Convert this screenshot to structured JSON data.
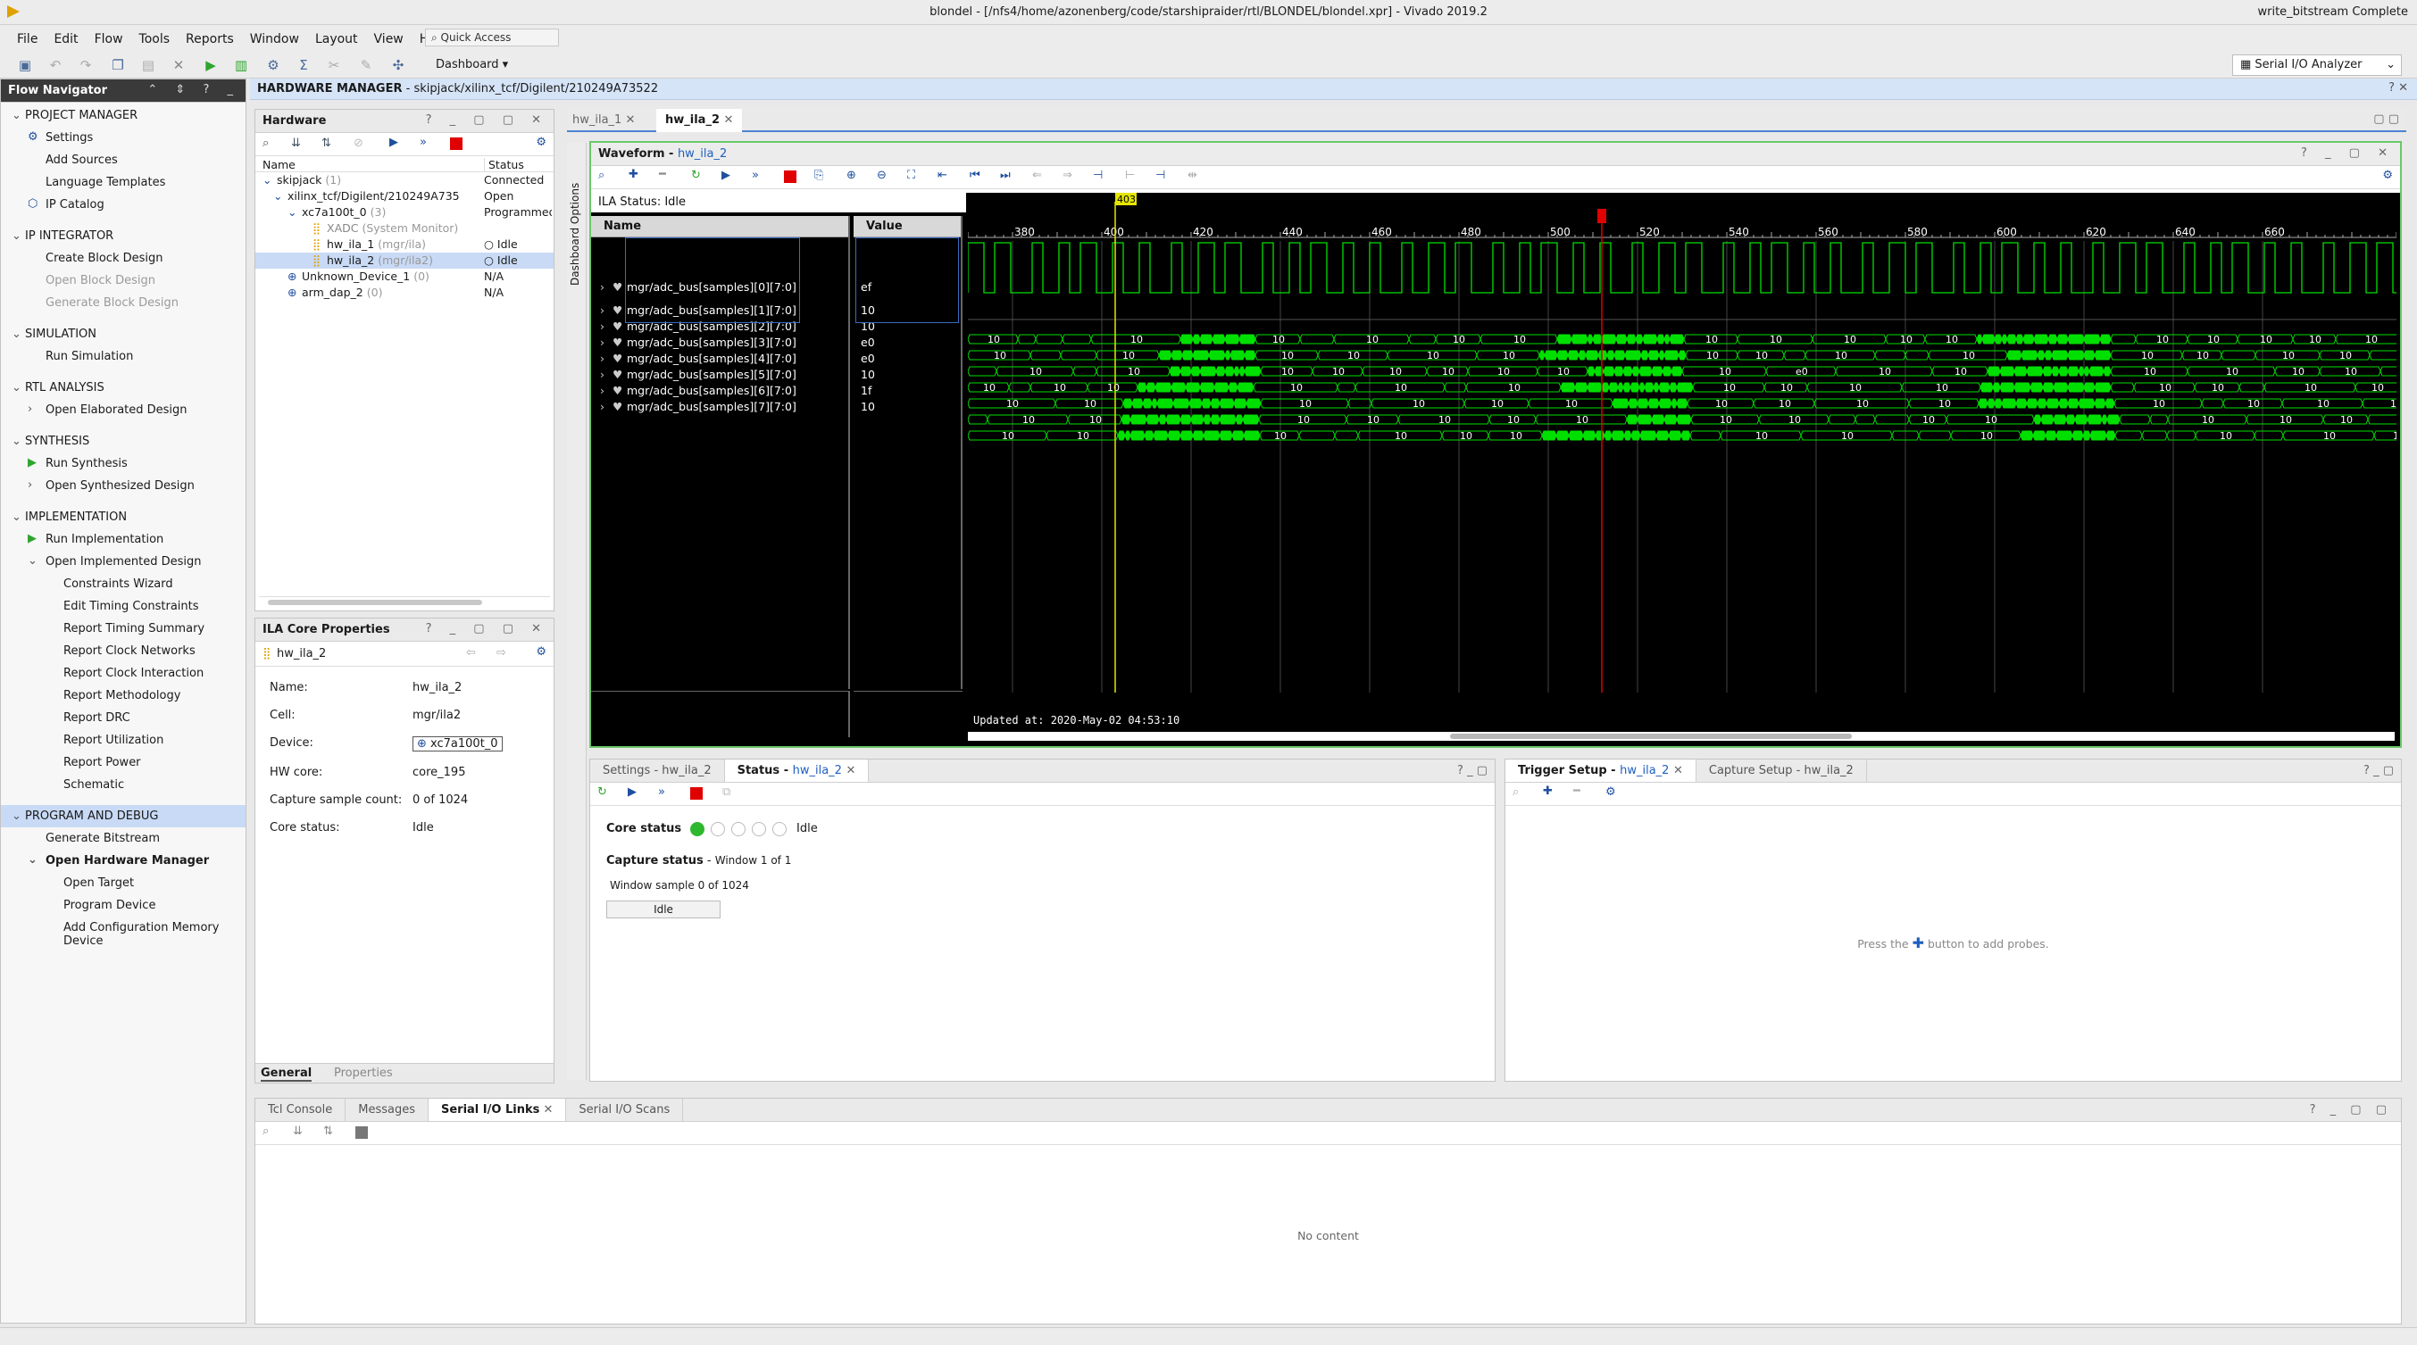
{
  "window": {
    "title": "blondel - [/nfs4/home/azonenberg/code/starshipraider/rtl/BLONDEL/blondel.xpr] - Vivado 2019.2",
    "status": "write_bitstream Complete",
    "layout_select": "Serial I/O Analyzer"
  },
  "menu": [
    "File",
    "Edit",
    "Flow",
    "Tools",
    "Reports",
    "Window",
    "Layout",
    "View",
    "Help"
  ],
  "quick_access": "Quick Access",
  "dashboard": "Dashboard",
  "flow_nav": {
    "title": "Flow Navigator",
    "sections": [
      {
        "label": "PROJECT MANAGER",
        "items": [
          {
            "label": "Settings",
            "icon": "gear-icon"
          },
          {
            "label": "Add Sources"
          },
          {
            "label": "Language Templates"
          },
          {
            "label": "IP Catalog",
            "icon": "ip-icon"
          }
        ]
      },
      {
        "label": "IP INTEGRATOR",
        "items": [
          {
            "label": "Create Block Design"
          },
          {
            "label": "Open Block Design",
            "dim": true
          },
          {
            "label": "Generate Block Design",
            "dim": true
          }
        ]
      },
      {
        "label": "SIMULATION",
        "items": [
          {
            "label": "Run Simulation"
          }
        ]
      },
      {
        "label": "RTL ANALYSIS",
        "items": [
          {
            "label": "Open Elaborated Design"
          }
        ]
      },
      {
        "label": "SYNTHESIS",
        "items": [
          {
            "label": "Run Synthesis",
            "icon": "play-icon"
          },
          {
            "label": "Open Synthesized Design"
          }
        ]
      },
      {
        "label": "IMPLEMENTATION",
        "items": [
          {
            "label": "Run Implementation",
            "icon": "play-icon"
          },
          {
            "label": "Open Implemented Design"
          },
          {
            "label": "Constraints Wizard",
            "sub": true
          },
          {
            "label": "Edit Timing Constraints",
            "sub": true
          },
          {
            "label": "Report Timing Summary",
            "sub": true
          },
          {
            "label": "Report Clock Networks",
            "sub": true
          },
          {
            "label": "Report Clock Interaction",
            "sub": true
          },
          {
            "label": "Report Methodology",
            "sub": true
          },
          {
            "label": "Report DRC",
            "sub": true
          },
          {
            "label": "Report Utilization",
            "sub": true
          },
          {
            "label": "Report Power",
            "sub": true
          },
          {
            "label": "Schematic",
            "sub": true
          }
        ]
      },
      {
        "label": "PROGRAM AND DEBUG",
        "active": true,
        "items": [
          {
            "label": "Generate Bitstream"
          },
          {
            "label": "Open Hardware Manager",
            "bold": true
          },
          {
            "label": "Open Target",
            "sub": true
          },
          {
            "label": "Program Device",
            "sub": true
          },
          {
            "label": "Add Configuration Memory Device",
            "sub": true
          }
        ]
      }
    ]
  },
  "hw_manager": {
    "label": "HARDWARE MANAGER",
    "path": "skipjack/xilinx_tcf/Digilent/210249A73522"
  },
  "hardware": {
    "title": "Hardware",
    "col_name": "Name",
    "col_status": "Status",
    "rows": [
      {
        "name": "skipjack",
        "extra": "(1)",
        "status": "Connected"
      },
      {
        "name": "xilinx_tcf/Digilent/210249A735",
        "extra": "",
        "status": "Open"
      },
      {
        "name": "xc7a100t_0",
        "extra": "(3)",
        "status": "Programmed"
      },
      {
        "name": "XADC",
        "extra": "(System Monitor)",
        "status": ""
      },
      {
        "name": "hw_ila_1",
        "extra": "(mgr/ila)",
        "status": "Idle"
      },
      {
        "name": "hw_ila_2",
        "extra": "(mgr/ila2)",
        "status": "Idle"
      },
      {
        "name": "Unknown_Device_1",
        "extra": "(0)",
        "status": "N/A"
      },
      {
        "name": "arm_dap_2",
        "extra": "(0)",
        "status": "N/A"
      }
    ]
  },
  "ila_props": {
    "title": "ILA Core Properties",
    "core": "hw_ila_2",
    "props": [
      {
        "k": "Name:",
        "v": "hw_ila_2"
      },
      {
        "k": "Cell:",
        "v": "mgr/ila2"
      },
      {
        "k": "Device:",
        "v": "xc7a100t_0"
      },
      {
        "k": "HW core:",
        "v": "core_195"
      },
      {
        "k": "Capture sample count:",
        "v": "0 of 1024"
      },
      {
        "k": "Core status:",
        "v": "Idle"
      }
    ],
    "tabs": [
      "General",
      "Properties"
    ]
  },
  "editor_tabs": [
    "hw_ila_1",
    "hw_ila_2"
  ],
  "dashboard_options": "Dashboard Options",
  "waveform": {
    "title": "Waveform",
    "core": "hw_ila_2",
    "ila_status": "ILA Status: Idle",
    "col_name": "Name",
    "col_value": "Value",
    "cursor_label": "403",
    "updated": "Updated at: 2020-May-02 04:53:10",
    "ticks": [
      "380",
      "400",
      "420",
      "440",
      "460",
      "480",
      "500",
      "520",
      "540",
      "560",
      "580",
      "600",
      "620",
      "640",
      "660"
    ],
    "signals": [
      {
        "name": "mgr/adc_bus[samples][0][7:0]",
        "value": "ef"
      },
      {
        "name": "mgr/adc_bus[samples][1][7:0]",
        "value": "10"
      },
      {
        "name": "mgr/adc_bus[samples][2][7:0]",
        "value": "10"
      },
      {
        "name": "mgr/adc_bus[samples][3][7:0]",
        "value": "e0"
      },
      {
        "name": "mgr/adc_bus[samples][4][7:0]",
        "value": "e0"
      },
      {
        "name": "mgr/adc_bus[samples][5][7:0]",
        "value": "10"
      },
      {
        "name": "mgr/adc_bus[samples][6][7:0]",
        "value": "1f"
      },
      {
        "name": "mgr/adc_bus[samples][7][7:0]",
        "value": "10"
      }
    ],
    "bus_labels": [
      "10",
      "e0",
      "ef",
      "1f"
    ]
  },
  "status_panel": {
    "tab_settings": "Settings - hw_ila_2",
    "tab_status": "Status",
    "core": "hw_ila_2",
    "core_status_label": "Core status",
    "core_status": "Idle",
    "capture_status_label": "Capture status",
    "window": "Window 1 of 1",
    "window_sample": "Window sample 0 of 1024",
    "idle_btn": "Idle"
  },
  "trigger_panel": {
    "tab_trigger": "Trigger Setup",
    "core": "hw_ila_2",
    "tab_capture": "Capture Setup - hw_ila_2",
    "hint_pre": "Press the",
    "hint_post": "button to add probes."
  },
  "bottom": {
    "tabs": [
      "Tcl Console",
      "Messages",
      "Serial I/O Links",
      "Serial I/O Scans"
    ],
    "active": 2,
    "no_content": "No content"
  },
  "colors": {
    "accent": "#1f5fbf",
    "wave": "#00e000",
    "nav_active": "#c8daf5",
    "cursor": "#e5e500",
    "marker": "#e00000"
  }
}
